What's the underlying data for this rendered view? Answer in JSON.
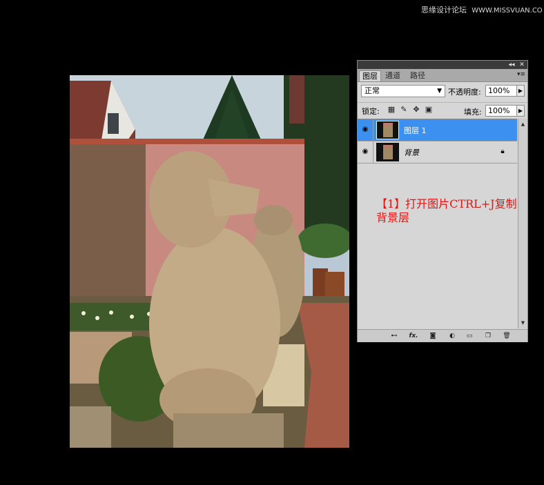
{
  "watermark": {
    "site_cn": "思缘设计论坛",
    "site_url": "WWW.MISSVUAN.COM"
  },
  "canvas": {
    "icon": "photo-canvas"
  },
  "panel": {
    "titlebar_icons": [
      "collapse-icon",
      "close-icon"
    ],
    "collapse_glyph": "◂◂",
    "close_glyph": "✕",
    "tabs": [
      {
        "label": "图层",
        "active": true
      },
      {
        "label": "通道",
        "active": false
      },
      {
        "label": "路径",
        "active": false
      }
    ],
    "menu_glyph": "▾≡",
    "blend_mode": "正常",
    "opacity_label": "不透明度:",
    "opacity_value": "100%",
    "lock_label": "锁定:",
    "fill_label": "填充:",
    "fill_value": "100%",
    "layers": [
      {
        "name": "图层 1",
        "selected": true,
        "visible": true,
        "locked": false
      },
      {
        "name": "背景",
        "selected": false,
        "visible": true,
        "locked": true
      }
    ],
    "footer_icons": [
      "link-layers-icon",
      "fx-icon",
      "mask-icon",
      "adjustment-icon",
      "group-icon",
      "new-layer-icon",
      "trash-icon"
    ],
    "fx_glyph": "fx."
  },
  "annotation": {
    "line1": "【1】打开图片CTRL+J复制",
    "line2": "背景层",
    "color": "#e8120f"
  },
  "colors": {
    "selection": "#3b90f0",
    "panel_bg": "#d6d6d6"
  }
}
